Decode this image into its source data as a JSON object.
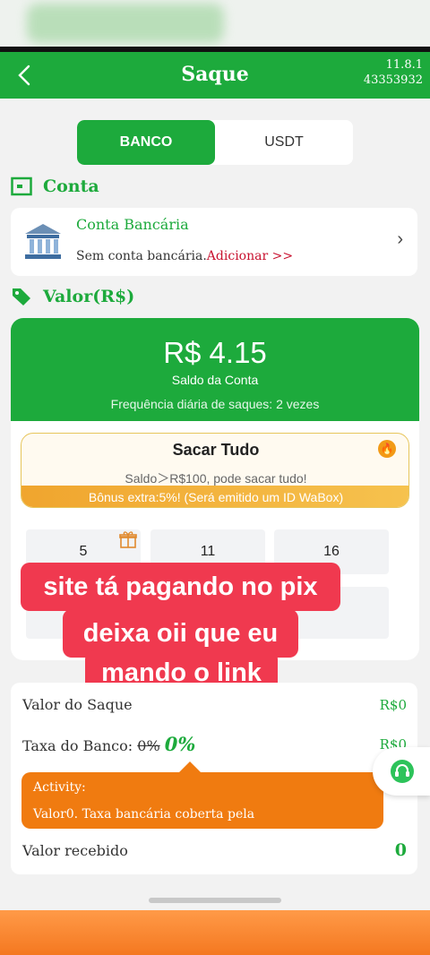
{
  "header": {
    "back_icon": "chevron-left-icon",
    "title": "Saque",
    "version": "11.8.1",
    "user_id": "43353932"
  },
  "tabs": [
    {
      "label": "BANCO",
      "active": true
    },
    {
      "label": "USDT",
      "active": false
    }
  ],
  "account_section": {
    "title": "Conta",
    "icon": "wallet-icon",
    "card": {
      "name": "Conta Bancária",
      "status": "Sem conta bancária.",
      "add_link": "Adicionar >>",
      "chevron": "›"
    }
  },
  "value_section": {
    "title": "Valor(R$)",
    "icon": "tag-icon",
    "balance": "R$ 4.15",
    "balance_label": "Saldo da Conta",
    "frequency": "Frequência diária de saques: 2 vezes",
    "withdraw_all": {
      "title": "Sacar Tudo",
      "subtitle": "Saldo＞R$100, pode sacar tudo!",
      "bonus": "Bônus extra:5%! (Será emitido um ID WaBox)"
    },
    "amount_options": [
      "5",
      "11",
      "16"
    ]
  },
  "overlay": {
    "line1": "site tá pagando no pix",
    "line2": "deixa oii que eu",
    "line3": "mando o link"
  },
  "details": {
    "withdraw_label": "Valor do Saque",
    "withdraw_value": "R$0",
    "fee_label": "Taxa do Banco:",
    "fee_old": "0%",
    "fee_new": "0%",
    "fee_value": "R$0",
    "activity_title": "Activity:",
    "activity_text": "Valor0. Taxa bancária coberta pela",
    "received_label": "Valor recebido",
    "received_value": "0"
  },
  "colors": {
    "primary": "#1daa3c",
    "accent_red": "#c8102e",
    "orange": "#f07b10",
    "overlay": "#f0394f"
  }
}
